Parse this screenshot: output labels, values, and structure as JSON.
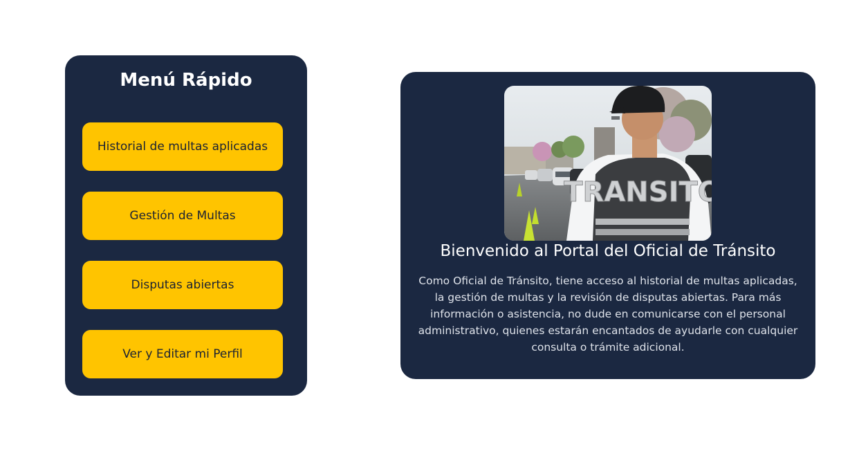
{
  "menu": {
    "title": "Menú Rápido",
    "items": [
      {
        "label": "Historial de multas aplicadas"
      },
      {
        "label": "Gestión de Multas"
      },
      {
        "label": "Disputas abiertas"
      },
      {
        "label": "Ver y Editar mi Perfil"
      }
    ]
  },
  "welcome": {
    "vest_text": "TRANSITO",
    "title": "Bienvenido al Portal del Oficial de Tránsito",
    "body": "Como Oficial de Tránsito, tiene acceso al historial de multas aplicadas, la gestión de multas y la revisión de disputas abiertas. Para más información o asistencia, no dude en comunicarse con el personal administrativo, quienes estarán encantados de ayudarle con cualquier consulta o trámite adicional."
  },
  "colors": {
    "card_background": "#1b2841",
    "button_background": "#ffc400",
    "button_text": "#1b2233",
    "title_text": "#ffffff"
  }
}
